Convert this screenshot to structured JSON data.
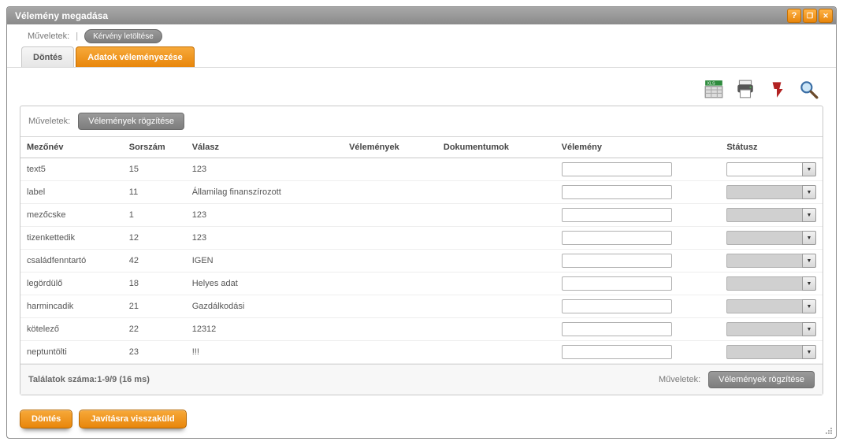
{
  "window": {
    "title": "Vélemény megadása"
  },
  "top": {
    "ops_label": "Műveletek:",
    "download_label": "Kérvény letöltése"
  },
  "tabs": {
    "decision": "Döntés",
    "review": "Adatok véleményezése"
  },
  "panel": {
    "ops_label": "Műveletek:",
    "record_label": "Vélemények rögzítése",
    "footer_results": "Találatok száma:1-9/9 (16 ms)",
    "footer_ops_label": "Műveletek:",
    "footer_record_label": "Vélemények rögzítése"
  },
  "columns": {
    "mezonev": "Mezőnév",
    "sorszam": "Sorszám",
    "valasz": "Válasz",
    "velemenyek": "Vélemények",
    "dokumentumok": "Dokumentumok",
    "velemeny": "Vélemény",
    "statusz": "Státusz"
  },
  "rows": [
    {
      "mezonev": "text5",
      "sorszam": "15",
      "valasz": "123",
      "status_enabled": true
    },
    {
      "mezonev": "label",
      "sorszam": "11",
      "valasz": "Államilag finanszírozott",
      "status_enabled": false
    },
    {
      "mezonev": "mezőcske",
      "sorszam": "1",
      "valasz": "123",
      "status_enabled": false
    },
    {
      "mezonev": "tizenkettedik",
      "sorszam": "12",
      "valasz": "123",
      "status_enabled": false
    },
    {
      "mezonev": "családfenntartó",
      "sorszam": "42",
      "valasz": "IGEN",
      "status_enabled": false
    },
    {
      "mezonev": "legördülő",
      "sorszam": "18",
      "valasz": "Helyes adat",
      "status_enabled": false
    },
    {
      "mezonev": "harmincadik",
      "sorszam": "21",
      "valasz": "Gazdálkodási",
      "status_enabled": false
    },
    {
      "mezonev": "kötelező",
      "sorszam": "22",
      "valasz": "12312",
      "status_enabled": false
    },
    {
      "mezonev": "neptuntölti",
      "sorszam": "23",
      "valasz": "!!!",
      "status_enabled": false
    }
  ],
  "bottom": {
    "decision": "Döntés",
    "sendback": "Javításra visszaküld"
  }
}
